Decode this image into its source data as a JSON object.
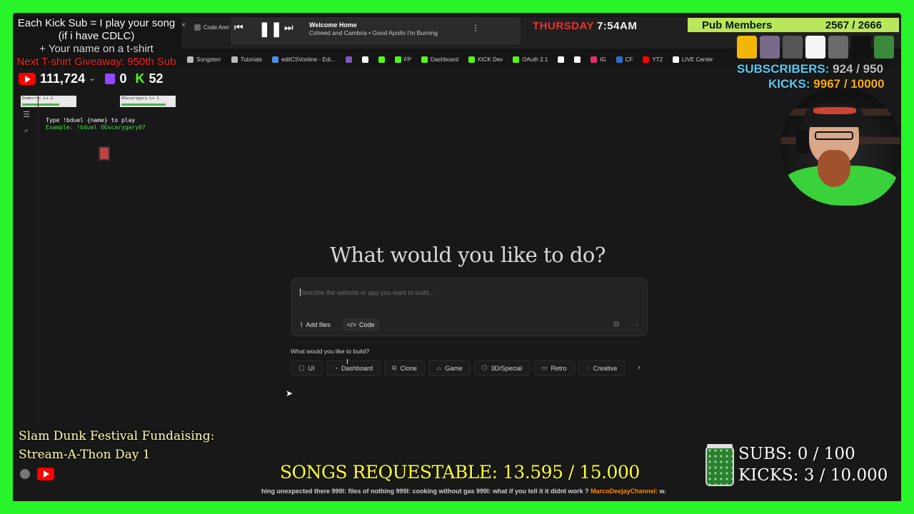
{
  "overlay": {
    "promo": [
      "Each Kick Sub = I play your song",
      "(if i have CDLC)",
      "+ Your name on a t-shirt",
      "Next T-shirt Giveaway: 950th Sub"
    ],
    "youtube_count": "111,724",
    "twitch_count": "0",
    "kick_count": "52",
    "day": "THURSDAY",
    "time": "7:54AM",
    "pub_members_label": "Pub Members",
    "pub_members_value": "2567 / 2666",
    "subscribers_label": "SUBSCRIBERS:",
    "subscribers_value": "924 / 950",
    "kicks_label": "KICKS:",
    "kicks_value": "9967 / 10000",
    "fundraiser_line1": "Slam Dunk Festival Fundaising:",
    "fundraiser_line2": "Stream-A-Thon Day 1",
    "songs_requestable": "SONGS REQUESTABLE: 13.595 / 15.000",
    "ticker": "hing unexpected there  999l: files of nothing  999l: cooking without gas  999l: what if you tell it it didnt work ?",
    "ticker_channel": "MarcoDeejayChannel:",
    "ticker_end": "w.",
    "subs_goal": "SUBS:  0 / 100",
    "kicks_goal": "KICKS: 3 / 10.000",
    "accent_green": "#27f52a"
  },
  "media": {
    "title": "Welcome Home",
    "subtitle": "Coheed and Cambria • Good Apollo I'm Burning"
  },
  "browser": {
    "tab_label": "Code Arer",
    "bookmarks": [
      {
        "label": "Songsterr",
        "icon": "folder-icon",
        "color": "#bbbbbb"
      },
      {
        "label": "Tutorials",
        "icon": "folder-icon",
        "color": "#bbbbbb"
      },
      {
        "label": "editCSVonline - Edi...",
        "icon": "csv-icon",
        "color": "#4a90e2"
      },
      {
        "label": "",
        "icon": "puzzle-icon",
        "color": "#7e57c2"
      },
      {
        "label": "",
        "icon": "google-icon",
        "color": "#ffffff"
      },
      {
        "label": "",
        "icon": "kick-icon",
        "color": "#53fc18"
      },
      {
        "label": "FP",
        "icon": "kick-icon",
        "color": "#53fc18"
      },
      {
        "label": "Dashboard",
        "icon": "kick-icon",
        "color": "#53fc18"
      },
      {
        "label": "KICK Dev",
        "icon": "kick-icon",
        "color": "#53fc18"
      },
      {
        "label": "OAuth 2.1",
        "icon": "kick-icon",
        "color": "#53fc18"
      },
      {
        "label": "",
        "icon": "tiktok-icon",
        "color": "#ffffff"
      },
      {
        "label": "",
        "icon": "x-icon",
        "color": "#ffffff"
      },
      {
        "label": "IG",
        "icon": "instagram-icon",
        "color": "#e1306c"
      },
      {
        "label": "CF",
        "icon": "cf-icon",
        "color": "#2f6fd1"
      },
      {
        "label": "YT2",
        "icon": "youtube-icon",
        "color": "#ff0000"
      },
      {
        "label": "LIVE Center",
        "icon": "tiktok-icon",
        "color": "#ffffff"
      }
    ]
  },
  "duel": {
    "left_name": "Dumerras  Lv.2",
    "right_name": "OGscarygary Lv.1",
    "instruction": "Type !bduel {name} to play",
    "example": "Example: !bduel OGscarygary07"
  },
  "app": {
    "heading": "What would you like to do?",
    "prompt_placeholder": "Describe the website or app you want to build...",
    "add_files": "Add files",
    "code": "Code",
    "build_label": "What would you like to build?",
    "categories": [
      {
        "label": "UI",
        "icon": "square-icon",
        "glyph": "▢"
      },
      {
        "label": "Dashboard",
        "icon": "gauge-icon",
        "glyph": "◔"
      },
      {
        "label": "Clone",
        "icon": "copy-icon",
        "glyph": "⧉"
      },
      {
        "label": "Game",
        "icon": "gamepad-icon",
        "glyph": "⌓"
      },
      {
        "label": "3D/Special",
        "icon": "cube-icon",
        "glyph": "⬡"
      },
      {
        "label": "Retro",
        "icon": "monitor-icon",
        "glyph": "▭"
      },
      {
        "label": "Creative",
        "icon": "palette-icon",
        "glyph": "◌"
      }
    ]
  }
}
